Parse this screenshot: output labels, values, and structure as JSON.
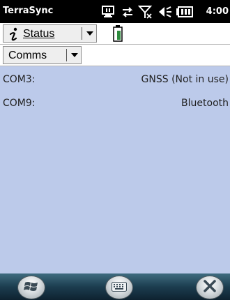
{
  "titlebar": {
    "app_title": "TerraSync",
    "clock": "4:00",
    "tray_icons": [
      "connectivity-icon",
      "sync-arrows-icon",
      "signal-off-icon",
      "speaker-icon",
      "battery-status-icon"
    ]
  },
  "toolbar": {
    "section_dropdown": {
      "label": "Status",
      "icon": "info-icon"
    },
    "status_indicator": "battery-charging-icon",
    "subsection_dropdown": {
      "label": "Comms"
    }
  },
  "comms_list": [
    {
      "port": "COM3:",
      "usage": "GNSS (Not in use)"
    },
    {
      "port": "COM9:",
      "usage": "Bluetooth"
    }
  ],
  "taskbar": {
    "buttons": [
      "windows-start-icon",
      "keyboard-icon",
      "close-icon"
    ]
  },
  "colors": {
    "titlebar_bg": "#000000",
    "content_bg": "#bccaea",
    "battery_fill": "#2e8b3e"
  }
}
